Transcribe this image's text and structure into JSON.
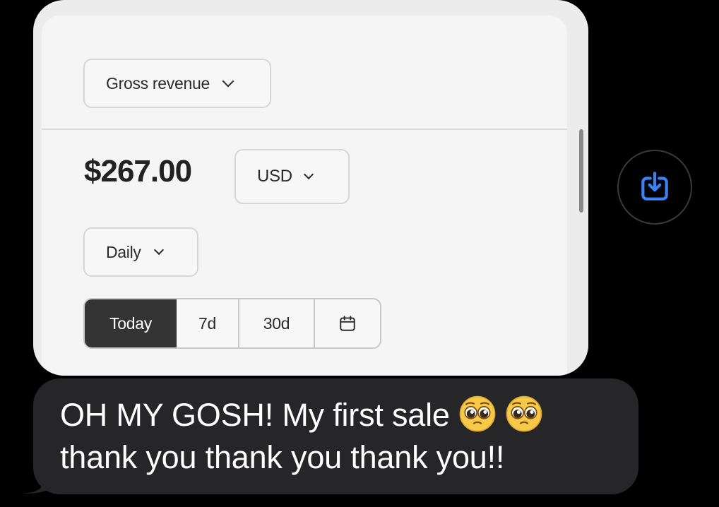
{
  "screenshot_card": {
    "metric_select": {
      "value": "Gross revenue"
    },
    "amount": "$267.00",
    "currency_select": {
      "value": "USD"
    },
    "interval_select": {
      "value": "Daily"
    },
    "range_buttons": [
      {
        "label": "Today",
        "active": true
      },
      {
        "label": "7d",
        "active": false
      },
      {
        "label": "30d",
        "active": false
      },
      {
        "icon": "calendar-icon",
        "active": false
      }
    ]
  },
  "save_button": {
    "icon": "save-download-icon",
    "color": "#3b82f6"
  },
  "message": {
    "line1": "OH MY GOSH! My first sale",
    "line2": "thank you thank you thank you!!",
    "emojis": [
      "pleading-face",
      "pleading-face"
    ]
  },
  "colors": {
    "bubble": "#262628",
    "background": "#000000",
    "active_range": "#333333",
    "icon_accent": "#3b82f6"
  }
}
